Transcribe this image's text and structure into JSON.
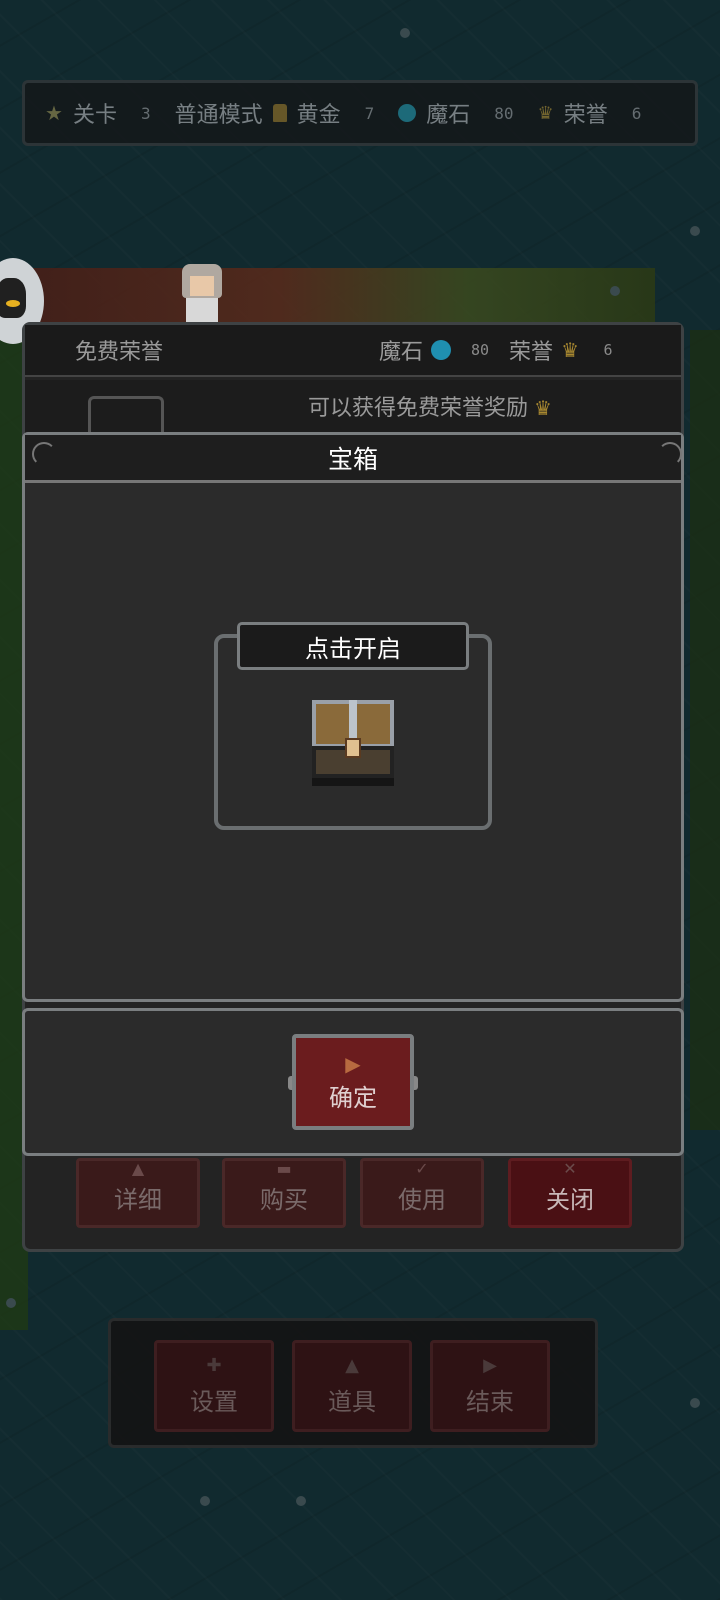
{
  "status_bar": {
    "level_label": "关卡",
    "level_value": "3",
    "mode": "普通模式",
    "gold_label": "黄金",
    "gold_value": "7",
    "magic_stone_label": "魔石",
    "magic_stone_value": "80",
    "honor_label": "荣誉",
    "honor_value": "6"
  },
  "honor_panel": {
    "title": "免费荣誉",
    "magic_stone_label": "魔石",
    "magic_stone_value": "80",
    "honor_label": "荣誉",
    "honor_value": "6",
    "free_reward_message": "可以获得免费荣誉奖励",
    "buttons": {
      "detail": "详细",
      "buy": "购买",
      "use": "使用",
      "close": "关闭"
    }
  },
  "chest_dialog": {
    "title": "宝箱",
    "open_prompt": "点击开启",
    "confirm_label": "确定"
  },
  "bottom_menu": {
    "settings": "设置",
    "items": "道具",
    "end": "结束"
  },
  "colors": {
    "background": "#112a2f",
    "panel": "#2b2b2b",
    "button_red": "#6b1c1e",
    "gem": "#1f8fb0",
    "crown": "#a88830"
  },
  "icons": {
    "level": "star-icon",
    "gold": "gold-bar-icon",
    "magic_stone": "gem-icon",
    "honor": "crown-icon",
    "chest": "treasure-chest-icon"
  }
}
